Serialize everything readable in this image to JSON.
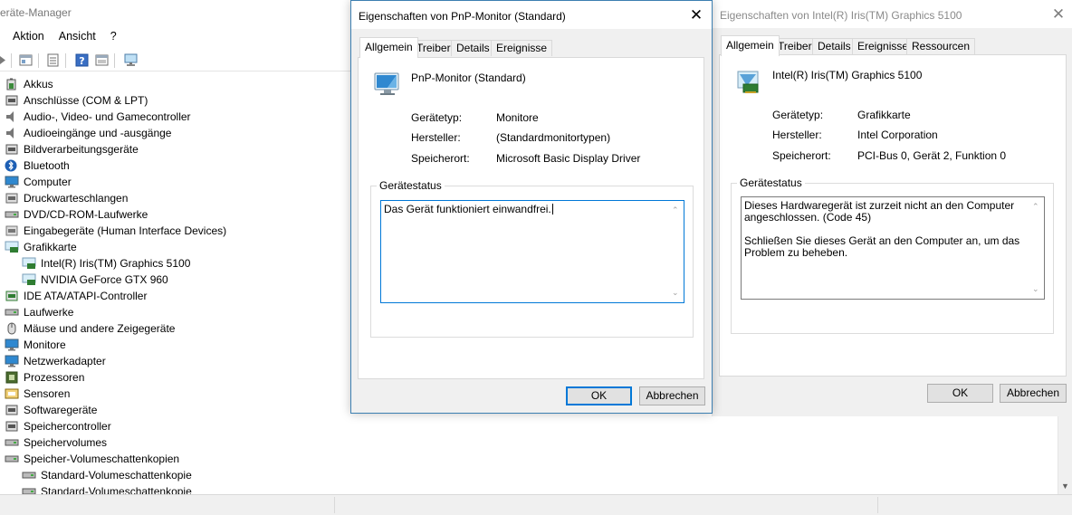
{
  "device_manager": {
    "title": "eräte-Manager",
    "menu": [
      "Aktion",
      "Ansicht",
      "?"
    ],
    "tree": [
      {
        "label": "Akkus",
        "icon": "battery-icon",
        "level": 0
      },
      {
        "label": "Anschlüsse (COM & LPT)",
        "icon": "port-icon",
        "level": 0
      },
      {
        "label": "Audio-, Video- und Gamecontroller",
        "icon": "speaker-icon",
        "level": 0
      },
      {
        "label": "Audioeingänge und -ausgänge",
        "icon": "speaker-icon",
        "level": 0
      },
      {
        "label": "Bildverarbeitungsgeräte",
        "icon": "camera-icon",
        "level": 0
      },
      {
        "label": "Bluetooth",
        "icon": "bluetooth-icon",
        "level": 0
      },
      {
        "label": "Computer",
        "icon": "computer-icon",
        "level": 0
      },
      {
        "label": "Druckwarteschlangen",
        "icon": "printer-icon",
        "level": 0
      },
      {
        "label": "DVD/CD-ROM-Laufwerke",
        "icon": "disc-drive-icon",
        "level": 0
      },
      {
        "label": "Eingabegeräte (Human Interface Devices)",
        "icon": "hid-icon",
        "level": 0
      },
      {
        "label": "Grafikkarte",
        "icon": "display-adapter-icon",
        "level": 0
      },
      {
        "label": "Intel(R) Iris(TM) Graphics 5100",
        "icon": "display-adapter-icon",
        "level": 1
      },
      {
        "label": "NVIDIA GeForce GTX 960",
        "icon": "display-adapter-icon",
        "level": 1
      },
      {
        "label": "IDE ATA/ATAPI-Controller",
        "icon": "ide-icon",
        "level": 0
      },
      {
        "label": "Laufwerke",
        "icon": "drive-icon",
        "level": 0
      },
      {
        "label": "Mäuse und andere Zeigegeräte",
        "icon": "mouse-icon",
        "level": 0
      },
      {
        "label": "Monitore",
        "icon": "monitor-icon",
        "level": 0
      },
      {
        "label": "Netzwerkadapter",
        "icon": "network-icon",
        "level": 0
      },
      {
        "label": "Prozessoren",
        "icon": "processor-icon",
        "level": 0
      },
      {
        "label": "Sensoren",
        "icon": "sensor-icon",
        "level": 0
      },
      {
        "label": "Softwaregeräte",
        "icon": "software-device-icon",
        "level": 0
      },
      {
        "label": "Speichercontroller",
        "icon": "storage-controller-icon",
        "level": 0
      },
      {
        "label": "Speichervolumes",
        "icon": "volume-icon",
        "level": 0
      },
      {
        "label": "Speicher-Volumeschattenkopien",
        "icon": "volume-icon",
        "level": 0
      },
      {
        "label": "Standard-Volumeschattenkopie",
        "icon": "volume-icon",
        "level": 1
      },
      {
        "label": "Standard-Volumeschattenkopie",
        "icon": "volume-icon",
        "level": 1
      }
    ]
  },
  "dialog_monitor": {
    "title": "Eigenschaften von PnP-Monitor (Standard)",
    "tabs": [
      "Allgemein",
      "Treiber",
      "Details",
      "Ereignisse"
    ],
    "active_tab": "Allgemein",
    "device_name": "PnP-Monitor (Standard)",
    "props": [
      {
        "label": "Gerätetyp:",
        "value": "Monitore"
      },
      {
        "label": "Hersteller:",
        "value": "(Standardmonitortypen)"
      },
      {
        "label": "Speicherort:",
        "value": "Microsoft Basic Display Driver"
      }
    ],
    "status_group_label": "Gerätestatus",
    "status_text": "Das Gerät funktioniert einwandfrei.",
    "ok_label": "OK",
    "cancel_label": "Abbrechen"
  },
  "dialog_gpu": {
    "title": "Eigenschaften von Intel(R) Iris(TM) Graphics 5100",
    "tabs": [
      "Allgemein",
      "Treiber",
      "Details",
      "Ereignisse",
      "Ressourcen"
    ],
    "active_tab": "Allgemein",
    "device_name": "Intel(R) Iris(TM) Graphics 5100",
    "props": [
      {
        "label": "Gerätetyp:",
        "value": "Grafikkarte"
      },
      {
        "label": "Hersteller:",
        "value": "Intel Corporation"
      },
      {
        "label": "Speicherort:",
        "value": "PCI-Bus 0, Gerät 2, Funktion 0"
      }
    ],
    "status_group_label": "Gerätestatus",
    "status_lines": [
      "Dieses Hardwaregerät ist zurzeit nicht an den Computer angeschlossen. (Code 45)",
      "Schließen Sie dieses Gerät an den Computer an, um das Problem zu beheben."
    ],
    "ok_label": "OK",
    "cancel_label": "Abbrechen"
  },
  "colors": {
    "accent": "#0078d7",
    "window_bg": "#f0f0f0",
    "border": "#d9d9d9"
  }
}
